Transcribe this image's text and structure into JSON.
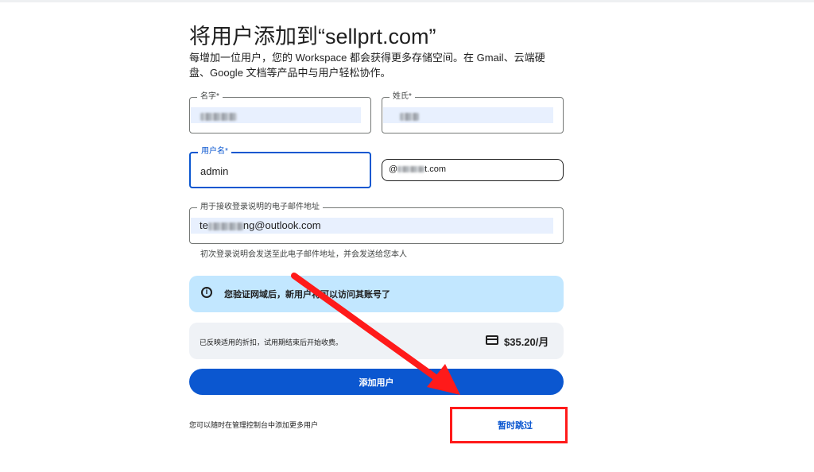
{
  "page": {
    "title": "将用户添加到“sellprt.com”",
    "subtitle": "每增加一位用户，您的 Workspace 都会获得更多存储空间。在 Gmail、云端硬盘、Google 文档等产品中与用户轻松协作。"
  },
  "form": {
    "first_name": {
      "label": "名字*"
    },
    "last_name": {
      "label": "姓氏*"
    },
    "username": {
      "label": "用户名*",
      "value": "admin"
    },
    "domain": {
      "prefix": "@",
      "suffix": "t.com"
    },
    "email": {
      "label": "用于接收登录说明的电子邮件地址",
      "value_prefix": "te",
      "value_mid": "ng@outlook.com"
    },
    "hint": "初次登录说明会发送至此电子邮件地址，并会发送给您本人"
  },
  "info_banner": {
    "icon": "info-icon",
    "text": "您验证网域后，新用户将可以访问其账号了"
  },
  "pricing": {
    "note": "已反映适用的折扣，试用期结束后开始收费。",
    "icon": "credit-card-icon",
    "price": "$35.20/月"
  },
  "actions": {
    "add_user": "添加用户",
    "footer_note": "您可以随时在管理控制台中添加更多用户",
    "skip": "暂时跳过"
  },
  "colors": {
    "primary": "#0b57d0",
    "banner": "#c2e7ff",
    "price_box": "#eff2f6",
    "annotation": "#ff1a1a"
  }
}
